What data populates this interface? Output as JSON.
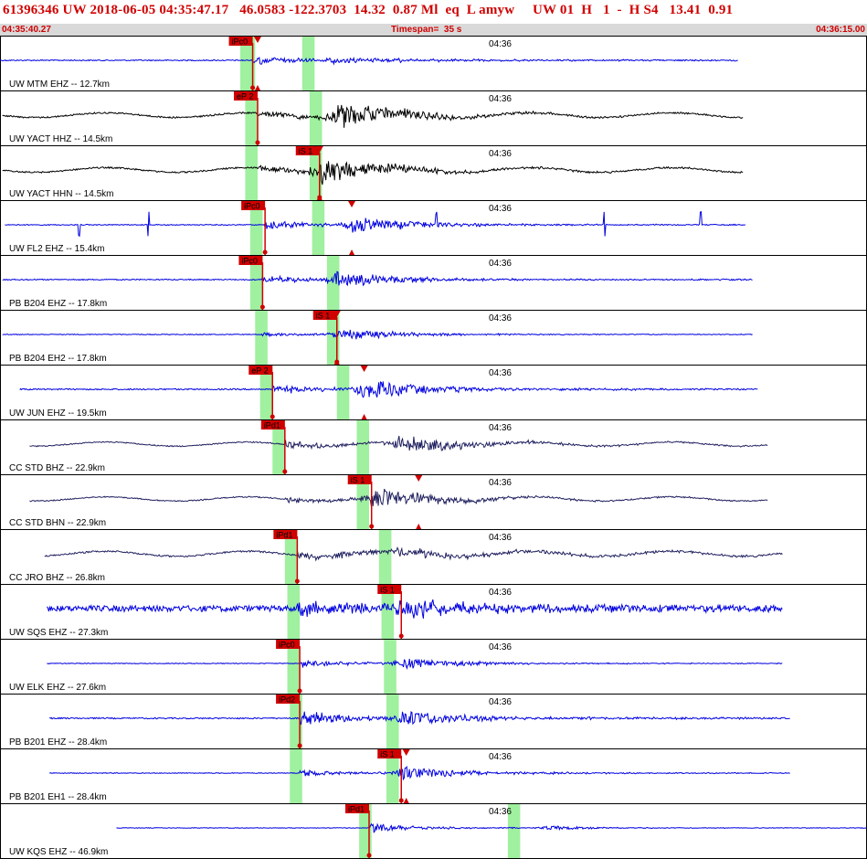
{
  "header": {
    "title": "61396346 UW 2018-06-05 04:35:47.17   46.0583 -122.3703  14.32  0.87 Ml  eq  L amyw     UW 01  H   1  -  H S4   13.41  0.91",
    "start_time": "04:35:40.27",
    "timespan": "Timespan=  35 s",
    "end_time": "04:36:15.00"
  },
  "colors": {
    "accent_red": "#d00000",
    "subbar": "#d9d9d9",
    "window_green": "#9ff09f",
    "trace_blue": "#0000e0",
    "trace_black": "#000000",
    "trace_navy": "#202060"
  },
  "chart_data": {
    "type": "line",
    "x_axis": {
      "unit": "s",
      "min": 0,
      "max": 35,
      "start": "04:35:40.27",
      "end": "04:36:15.00",
      "tick_label": "04:36",
      "tick_time": 19.73
    },
    "traces": [
      {
        "label": "UW MTM EHZ -- 12.7km",
        "color": "blue",
        "start": 0.0,
        "end": 29.8,
        "noise": 0.6,
        "onset": 10.2,
        "onset_amp": 4,
        "decay": 10,
        "sec_time": 13.3,
        "sec_amp": 3,
        "spikes": [],
        "picks": [
          {
            "label": "iPc0",
            "time": 10.2
          }
        ],
        "pred_marks": [
          10.4
        ],
        "windows": [
          [
            9.7,
            10.3
          ],
          [
            12.2,
            12.7
          ]
        ]
      },
      {
        "label": "UW YACT HHZ -- 14.5km",
        "color": "black",
        "start": 0.1,
        "end": 30.0,
        "noise": 0.8,
        "onset": 10.4,
        "onset_amp": 3,
        "decay": 9,
        "sec_time": 13.6,
        "sec_amp": 14,
        "spikes": [],
        "picks": [
          {
            "label": "eP 2",
            "time": 10.4
          }
        ],
        "pred_marks": [],
        "windows": [
          [
            9.9,
            10.4
          ],
          [
            12.5,
            13.0
          ]
        ]
      },
      {
        "label": "UW YACT HHN -- 14.5km",
        "color": "black",
        "start": 0.1,
        "end": 30.0,
        "noise": 0.8,
        "onset": 10.4,
        "onset_amp": 2,
        "decay": 9,
        "sec_time": 12.9,
        "sec_amp": 13,
        "spikes": [],
        "picks": [
          {
            "label": "iS 1",
            "time": 12.9
          }
        ],
        "pred_marks": [
          12.9
        ],
        "windows": [
          [
            9.9,
            10.4
          ],
          [
            12.5,
            13.0
          ]
        ]
      },
      {
        "label": "UW FL2 EHZ -- 15.4km",
        "color": "blue",
        "start": 0.2,
        "end": 30.1,
        "noise": 0.5,
        "onset": 10.7,
        "onset_amp": 4,
        "decay": 9,
        "sec_time": 14.2,
        "sec_amp": 9,
        "spikes": [
          3.2,
          6.0,
          17.6,
          24.4,
          28.3
        ],
        "picks": [
          {
            "label": "iPc0",
            "time": 10.7
          }
        ],
        "pred_marks": [
          14.2
        ],
        "windows": [
          [
            10.1,
            10.6
          ],
          [
            12.6,
            13.1
          ]
        ]
      },
      {
        "label": "PB B204 EHZ -- 17.8km",
        "color": "blue",
        "start": 0.1,
        "end": 30.4,
        "noise": 0.6,
        "onset": 10.6,
        "onset_amp": 3,
        "decay": 10,
        "sec_time": 13.6,
        "sec_amp": 8,
        "spikes": [],
        "picks": [
          {
            "label": "iPc0",
            "time": 10.6
          }
        ],
        "pred_marks": [],
        "windows": [
          [
            10.1,
            10.6
          ],
          [
            13.2,
            13.7
          ]
        ]
      },
      {
        "label": "PB B204 EH2 -- 17.8km",
        "color": "blue",
        "start": 0.1,
        "end": 30.4,
        "noise": 0.4,
        "onset": 10.6,
        "onset_amp": 1,
        "decay": 8,
        "sec_time": 13.6,
        "sec_amp": 6,
        "spikes": [],
        "picks": [
          {
            "label": "iS 1",
            "time": 13.6
          }
        ],
        "pred_marks": [
          13.6
        ],
        "windows": [
          [
            10.3,
            10.8
          ],
          [
            13.2,
            13.7
          ]
        ]
      },
      {
        "label": "UW JUN EHZ -- 19.5km",
        "color": "blue",
        "start": 0.8,
        "end": 30.6,
        "noise": 0.7,
        "onset": 11.0,
        "onset_amp": 3,
        "decay": 10,
        "sec_time": 14.7,
        "sec_amp": 11,
        "spikes": [],
        "picks": [
          {
            "label": "eP 2",
            "time": 11.0
          }
        ],
        "pred_marks": [
          14.7
        ],
        "windows": [
          [
            10.5,
            11.0
          ],
          [
            13.6,
            14.1
          ]
        ]
      },
      {
        "label": "CC STD BHZ -- 22.9km",
        "color": "navy",
        "start": 1.2,
        "end": 31.0,
        "noise": 0.6,
        "onset": 11.5,
        "onset_amp": 4,
        "decay": 11,
        "sec_time": 16.0,
        "sec_amp": 10,
        "spikes": [],
        "picks": [
          {
            "label": "iPd1",
            "time": 11.5
          }
        ],
        "pred_marks": [],
        "windows": [
          [
            11.0,
            11.5
          ],
          [
            14.4,
            14.9
          ]
        ]
      },
      {
        "label": "CC STD BHN -- 22.9km",
        "color": "navy",
        "start": 1.2,
        "end": 31.0,
        "noise": 0.6,
        "onset": 11.5,
        "onset_amp": 2,
        "decay": 11,
        "sec_time": 15.0,
        "sec_amp": 12,
        "spikes": [],
        "picks": [
          {
            "label": "iS 1",
            "time": 15.0
          }
        ],
        "pred_marks": [
          16.9
        ],
        "windows": [
          [
            14.4,
            14.9
          ]
        ]
      },
      {
        "label": "CC JRO BHZ -- 26.8km",
        "color": "navy",
        "start": 1.8,
        "end": 31.6,
        "noise": 0.9,
        "onset": 12.0,
        "onset_amp": 3,
        "decay": 12,
        "sec_time": 16.2,
        "sec_amp": 5,
        "spikes": [],
        "picks": [
          {
            "label": "iPd1",
            "time": 12.0
          }
        ],
        "pred_marks": [],
        "windows": [
          [
            11.5,
            12.0
          ],
          [
            15.3,
            15.8
          ]
        ]
      },
      {
        "label": "UW SQS EHZ -- 27.3km",
        "color": "blue",
        "start": 1.9,
        "end": 31.6,
        "noise": 3.2,
        "onset": 12.0,
        "onset_amp": 3,
        "decay": 12,
        "sec_time": 16.2,
        "sec_amp": 9,
        "spikes": [],
        "picks": [
          {
            "label": "iS 1",
            "time": 16.2
          }
        ],
        "pred_marks": [],
        "windows": [
          [
            11.6,
            12.1
          ],
          [
            15.4,
            15.9
          ]
        ]
      },
      {
        "label": "UW ELK EHZ -- 27.6km",
        "color": "blue",
        "start": 1.9,
        "end": 31.6,
        "noise": 0.4,
        "onset": 12.1,
        "onset_amp": 4,
        "decay": 10,
        "sec_time": 16.2,
        "sec_amp": 6,
        "spikes": [],
        "picks": [
          {
            "label": "iPc0",
            "time": 12.1
          }
        ],
        "pred_marks": [],
        "windows": [
          [
            11.6,
            12.1
          ],
          [
            15.5,
            16.0
          ]
        ]
      },
      {
        "label": "PB B201 EHZ -- 28.4km",
        "color": "blue",
        "start": 2.0,
        "end": 31.9,
        "noise": 0.7,
        "onset": 12.1,
        "onset_amp": 9,
        "decay": 13,
        "sec_time": 16.2,
        "sec_amp": 8,
        "spikes": [],
        "picks": [
          {
            "label": "iPd2",
            "time": 12.1
          }
        ],
        "pred_marks": [],
        "windows": [
          [
            11.7,
            12.2
          ],
          [
            15.6,
            16.1
          ]
        ]
      },
      {
        "label": "PB B201 EH1 -- 28.4km",
        "color": "blue",
        "start": 2.0,
        "end": 31.9,
        "noise": 0.4,
        "onset": 12.1,
        "onset_amp": 3,
        "decay": 12,
        "sec_time": 16.2,
        "sec_amp": 7,
        "spikes": [],
        "picks": [
          {
            "label": "iS 1",
            "time": 16.2
          }
        ],
        "pred_marks": [
          16.4
        ],
        "windows": [
          [
            11.7,
            12.2
          ],
          [
            15.6,
            16.1
          ]
        ]
      },
      {
        "label": "UW KQS EHZ -- 46.9km",
        "color": "blue",
        "start": 4.7,
        "end": 35.0,
        "noise": 0.3,
        "onset": 14.9,
        "onset_amp": 5,
        "decay": 8,
        "sec_time": 22.0,
        "sec_amp": 2,
        "spikes": [],
        "picks": [
          {
            "label": "iPd1",
            "time": 14.9
          }
        ],
        "pred_marks": [],
        "windows": [
          [
            14.5,
            15.0
          ],
          [
            20.5,
            21.0
          ]
        ]
      }
    ]
  }
}
